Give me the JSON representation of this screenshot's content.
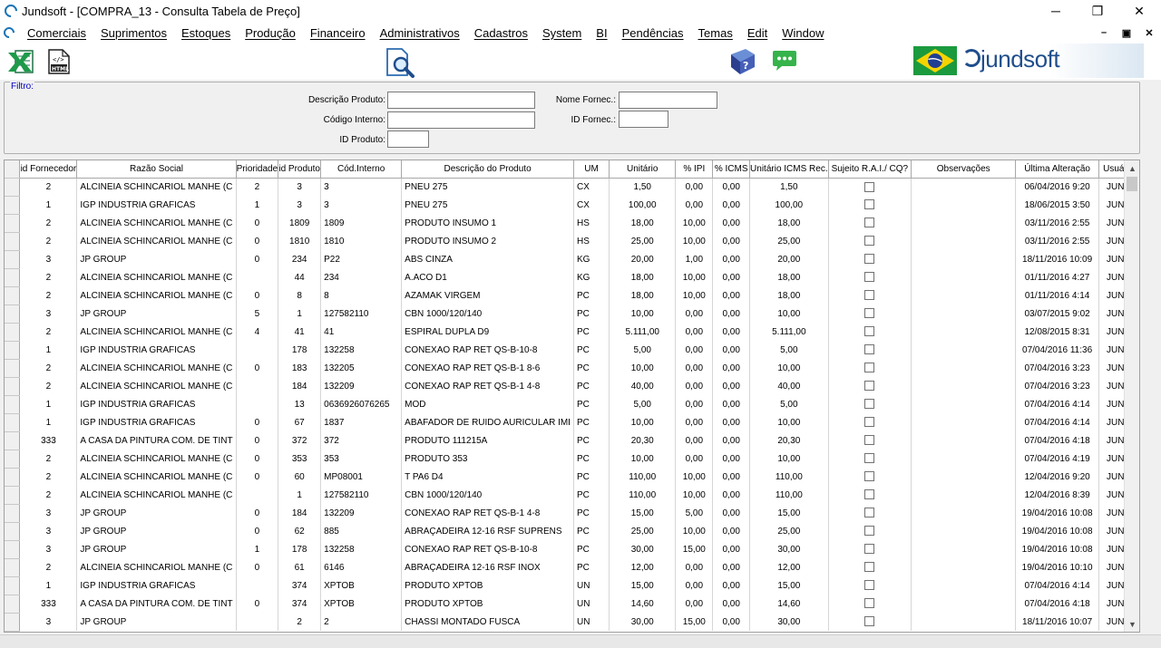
{
  "window": {
    "title": "Jundsoft - [COMPRA_13 - Consulta Tabela de Preço]",
    "minimize": "─",
    "maximize": "❐",
    "close": "✕"
  },
  "menu": [
    "Comerciais",
    "Suprimentos",
    "Estoques",
    "Produção",
    "Financeiro",
    "Administrativos",
    "Cadastros",
    "System",
    "BI",
    "Pendências",
    "Temas",
    "Edit",
    "Window"
  ],
  "mdi": {
    "minimize": "–",
    "restore": "▣",
    "close": "✕"
  },
  "toolbar": {
    "logo_text": "jundsoft",
    "icons": [
      "excel-export-icon",
      "html-export-icon",
      "search-icon",
      "help-book-icon",
      "chat-icon",
      "brazil-flag-icon"
    ]
  },
  "filter": {
    "legend": "Filtro:",
    "descricao_label": "Descrição Produto:",
    "descricao_value": "",
    "codigo_label": "Código Interno:",
    "codigo_value": "",
    "id_produto_label": "ID Produto:",
    "id_produto_value": "",
    "nome_fornec_label": "Nome Fornec.:",
    "nome_fornec_value": "",
    "id_fornec_label": "ID Fornec.:",
    "id_fornec_value": ""
  },
  "table": {
    "columns": [
      "id Fornecedor",
      "Razão Social",
      "Prioridade",
      "id Produto",
      "Cód.Interno",
      "Descrição do Produto",
      "UM",
      "Unitário",
      "% IPI",
      "% ICMS",
      "Unitário ICMS Rec.",
      "Sujeito R.A.I./ CQ?",
      "Observações",
      "Última Alteração",
      "Usuário"
    ],
    "rows": [
      [
        "2",
        "ALCINEIA SCHINCARIOL MANHE (C",
        "2",
        "3",
        "3",
        "PNEU 275",
        "CX",
        "1,50",
        "0,00",
        "0,00",
        "1,50",
        "",
        "",
        "06/04/2016 9:20",
        "JUND"
      ],
      [
        "1",
        "IGP INDUSTRIA GRAFICAS",
        "1",
        "3",
        "3",
        "PNEU 275",
        "CX",
        "100,00",
        "0,00",
        "0,00",
        "100,00",
        "",
        "",
        "18/06/2015 3:50",
        "JUND"
      ],
      [
        "2",
        "ALCINEIA SCHINCARIOL MANHE (C",
        "0",
        "1809",
        "1809",
        "PRODUTO INSUMO 1",
        "HS",
        "18,00",
        "10,00",
        "0,00",
        "18,00",
        "",
        "",
        "03/11/2016 2:55",
        "JUND"
      ],
      [
        "2",
        "ALCINEIA SCHINCARIOL MANHE (C",
        "0",
        "1810",
        "1810",
        "PRODUTO INSUMO 2",
        "HS",
        "25,00",
        "10,00",
        "0,00",
        "25,00",
        "",
        "",
        "03/11/2016 2:55",
        "JUND"
      ],
      [
        "3",
        "JP GROUP",
        "0",
        "234",
        "P22",
        "ABS CINZA",
        "KG",
        "20,00",
        "1,00",
        "0,00",
        "20,00",
        "",
        "",
        "18/11/2016 10:09",
        "JUND"
      ],
      [
        "2",
        "ALCINEIA SCHINCARIOL MANHE (C",
        "",
        "44",
        "234",
        "A.ACO D1",
        "KG",
        "18,00",
        "10,00",
        "0,00",
        "18,00",
        "",
        "",
        "01/11/2016 4:27",
        "JUND"
      ],
      [
        "2",
        "ALCINEIA SCHINCARIOL MANHE (C",
        "0",
        "8",
        "8",
        "AZAMAK VIRGEM",
        "PC",
        "18,00",
        "10,00",
        "0,00",
        "18,00",
        "",
        "",
        "01/11/2016 4:14",
        "JUND"
      ],
      [
        "3",
        "JP GROUP",
        "5",
        "1",
        "127582110",
        "CBN 1000/120/140",
        "PC",
        "10,00",
        "0,00",
        "0,00",
        "10,00",
        "",
        "",
        "03/07/2015 9:02",
        "JUND"
      ],
      [
        "2",
        "ALCINEIA SCHINCARIOL MANHE (C",
        "4",
        "41",
        "41",
        "ESPIRAL DUPLA D9",
        "PC",
        "5.111,00",
        "0,00",
        "0,00",
        "5.111,00",
        "",
        "",
        "12/08/2015 8:31",
        "JUND"
      ],
      [
        "1",
        "IGP INDUSTRIA GRAFICAS",
        "",
        "178",
        "132258",
        "CONEXAO RAP RET QS-B-10-8",
        "PC",
        "5,00",
        "0,00",
        "0,00",
        "5,00",
        "",
        "",
        "07/04/2016 11:36",
        "JUND"
      ],
      [
        "2",
        "ALCINEIA SCHINCARIOL MANHE (C",
        "0",
        "183",
        "132205",
        "CONEXAO RAP RET QS-B-1 8-6",
        "PC",
        "10,00",
        "0,00",
        "0,00",
        "10,00",
        "",
        "",
        "07/04/2016 3:23",
        "JUND"
      ],
      [
        "2",
        "ALCINEIA SCHINCARIOL MANHE (C",
        "",
        "184",
        "132209",
        "CONEXAO RAP RET QS-B-1 4-8",
        "PC",
        "40,00",
        "0,00",
        "0,00",
        "40,00",
        "",
        "",
        "07/04/2016 3:23",
        "JUND"
      ],
      [
        "1",
        "IGP INDUSTRIA GRAFICAS",
        "",
        "13",
        "0636926076265",
        "MOD",
        "PC",
        "5,00",
        "0,00",
        "0,00",
        "5,00",
        "",
        "",
        "07/04/2016 4:14",
        "JUND"
      ],
      [
        "1",
        "IGP INDUSTRIA GRAFICAS",
        "0",
        "67",
        "1837",
        "ABAFADOR DE RUIDO AURICULAR IMI",
        "PC",
        "10,00",
        "0,00",
        "0,00",
        "10,00",
        "",
        "",
        "07/04/2016 4:14",
        "JUND"
      ],
      [
        "333",
        "A CASA DA PINTURA COM. DE TINT",
        "0",
        "372",
        "372",
        "PRODUTO 111215A",
        "PC",
        "20,30",
        "0,00",
        "0,00",
        "20,30",
        "",
        "",
        "07/04/2016 4:18",
        "JUND"
      ],
      [
        "2",
        "ALCINEIA SCHINCARIOL MANHE (C",
        "0",
        "353",
        "353",
        "PRODUTO 353",
        "PC",
        "10,00",
        "0,00",
        "0,00",
        "10,00",
        "",
        "",
        "07/04/2016 4:19",
        "JUND"
      ],
      [
        "2",
        "ALCINEIA SCHINCARIOL MANHE (C",
        "0",
        "60",
        "MP08001",
        "T PA6 D4",
        "PC",
        "110,00",
        "10,00",
        "0,00",
        "110,00",
        "",
        "",
        "12/04/2016 9:20",
        "JUND"
      ],
      [
        "2",
        "ALCINEIA SCHINCARIOL MANHE (C",
        "",
        "1",
        "127582110",
        "CBN 1000/120/140",
        "PC",
        "110,00",
        "10,00",
        "0,00",
        "110,00",
        "",
        "",
        "12/04/2016 8:39",
        "JUND"
      ],
      [
        "3",
        "JP GROUP",
        "0",
        "184",
        "132209",
        "CONEXAO RAP RET QS-B-1 4-8",
        "PC",
        "15,00",
        "5,00",
        "0,00",
        "15,00",
        "",
        "",
        "19/04/2016 10:08",
        "JUND"
      ],
      [
        "3",
        "JP GROUP",
        "0",
        "62",
        "885",
        "ABRAÇADEIRA 12-16 RSF SUPRENS",
        "PC",
        "25,00",
        "10,00",
        "0,00",
        "25,00",
        "",
        "",
        "19/04/2016 10:08",
        "JUND"
      ],
      [
        "3",
        "JP GROUP",
        "1",
        "178",
        "132258",
        "CONEXAO RAP RET QS-B-10-8",
        "PC",
        "30,00",
        "15,00",
        "0,00",
        "30,00",
        "",
        "",
        "19/04/2016 10:08",
        "JUND"
      ],
      [
        "2",
        "ALCINEIA SCHINCARIOL MANHE (C",
        "0",
        "61",
        "6146",
        "ABRAÇADEIRA 12-16 RSF INOX",
        "PC",
        "12,00",
        "0,00",
        "0,00",
        "12,00",
        "",
        "",
        "19/04/2016 10:10",
        "JUND"
      ],
      [
        "1",
        "IGP INDUSTRIA GRAFICAS",
        "",
        "374",
        "XPTOB",
        "PRODUTO XPTOB",
        "UN",
        "15,00",
        "0,00",
        "0,00",
        "15,00",
        "",
        "",
        "07/04/2016 4:14",
        "JUND"
      ],
      [
        "333",
        "A CASA DA PINTURA COM. DE TINT",
        "0",
        "374",
        "XPTOB",
        "PRODUTO XPTOB",
        "UN",
        "14,60",
        "0,00",
        "0,00",
        "14,60",
        "",
        "",
        "07/04/2016 4:18",
        "JUND"
      ],
      [
        "3",
        "JP GROUP",
        "",
        "2",
        "2",
        "CHASSI MONTADO FUSCA",
        "UN",
        "30,00",
        "15,00",
        "0,00",
        "30,00",
        "",
        "",
        "18/11/2016 10:07",
        "JUND"
      ]
    ]
  }
}
